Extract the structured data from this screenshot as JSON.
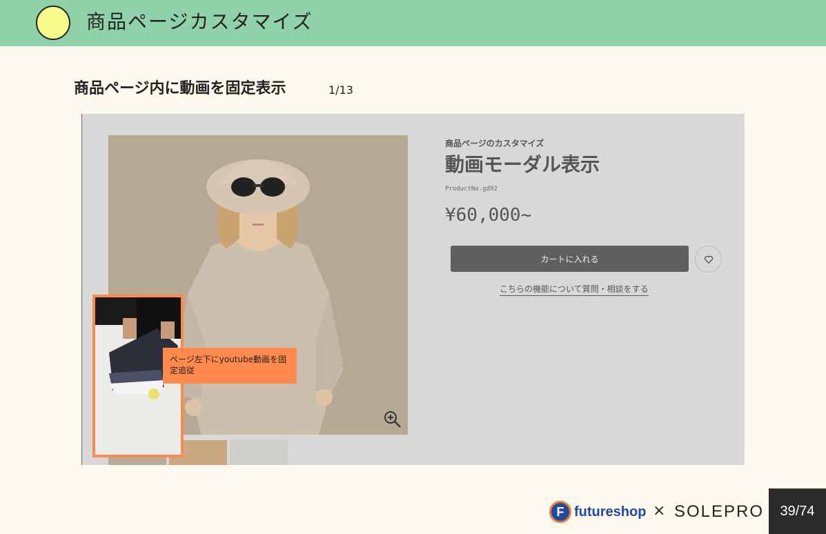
{
  "header": {
    "title": "商品ページカスタマイズ",
    "accent_color": "#8fd1a8",
    "circle_color": "#f6fb8a"
  },
  "section": {
    "title": "商品ページ内に動画を固定表示",
    "count": "1/13"
  },
  "screenshot": {
    "product": {
      "category": "商品ページのカスタマイズ",
      "name": "動画モーダル表示",
      "product_no": "ProductNo.gd92",
      "price": "¥60,000~"
    },
    "buttons": {
      "cart_label": "カートに入れる",
      "question_label": "こちらの機能について質問・相談をする"
    },
    "icons": {
      "zoom": "zoom-in-icon",
      "favorite": "heart-icon",
      "video": "video-thumbnail"
    },
    "callout": {
      "text": "ページ左下にyoutube動画を固定追従",
      "color": "#ff8a4c"
    }
  },
  "footer": {
    "logo_badge": "F",
    "logo_text": "futureshop",
    "times": "×",
    "partner": "SOLEPRO",
    "page": "39/74"
  }
}
